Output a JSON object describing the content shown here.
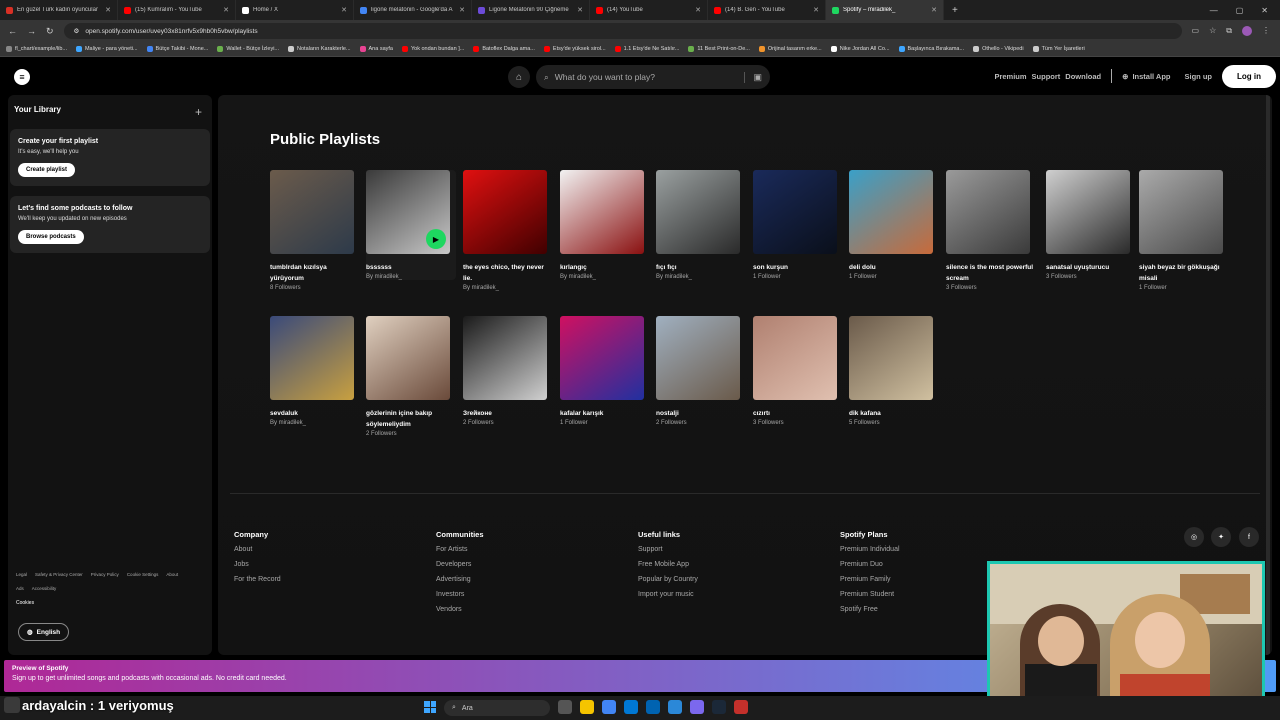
{
  "browser": {
    "tabs": [
      {
        "title": "En güzel Türk kadın oyuncular",
        "color": "#d93025"
      },
      {
        "title": "(15) Kumralım - YouTube",
        "color": "#ff0000"
      },
      {
        "title": "Home / X",
        "color": "#ffffff"
      },
      {
        "title": "ligone melatonin - Google'da A",
        "color": "#4285f4"
      },
      {
        "title": "Ligone Melatonin 90 Çiğneme",
        "color": "#6c4bd8"
      },
      {
        "title": "(14) YouTube",
        "color": "#ff0000"
      },
      {
        "title": "(14) B. Gen - YouTube",
        "color": "#ff0000"
      },
      {
        "title": "Spotify – miradilek_",
        "color": "#1ed760"
      }
    ],
    "url": "open.spotify.com/user/uvey03x81nrfv5x9hb0h5vbw/playlists",
    "bookmarks": [
      {
        "label": "fl_chart/example/lib...",
        "color": "#888888"
      },
      {
        "label": "Maliye - para yöneti...",
        "color": "#3ea6ff"
      },
      {
        "label": "Bütçe Takibi - Mone...",
        "color": "#4285f4"
      },
      {
        "label": "Wallet - Bütçe İzleyi...",
        "color": "#6ab04c"
      },
      {
        "label": "Notaların Karakterle...",
        "color": "#cccccc"
      },
      {
        "label": "Ana sayfa",
        "color": "#e84393"
      },
      {
        "label": "Yok ondan bundan ]...",
        "color": "#ff0000"
      },
      {
        "label": "Batoflex Dalga ama...",
        "color": "#ff0000"
      },
      {
        "label": "Etsy'de yüksek sirol...",
        "color": "#ff0000"
      },
      {
        "label": "1.1 Etsy'de Ne Satılır...",
        "color": "#ff0000"
      },
      {
        "label": "11 Best Print-on-De...",
        "color": "#6ab04c"
      },
      {
        "label": "Orijinal tasarım erke...",
        "color": "#f0932b"
      },
      {
        "label": "Nike Jordan All Co...",
        "color": "#ffffff"
      },
      {
        "label": "Başlayınca Bırakama...",
        "color": "#3ea6ff"
      },
      {
        "label": "Othello - Vikipedi",
        "color": "#cccccc"
      },
      {
        "label": "Tüm Yer İşaretleri",
        "color": "#cccccc"
      }
    ]
  },
  "spotify_header": {
    "search_placeholder": "What do you want to play?",
    "links": [
      "Premium",
      "Support",
      "Download"
    ],
    "install": "Install App",
    "signup": "Sign up",
    "login": "Log in"
  },
  "library": {
    "title": "Your Library",
    "card1": {
      "title": "Create your first playlist",
      "text": "It's easy, we'll help you",
      "button": "Create playlist"
    },
    "card2": {
      "title": "Let's find some podcasts to follow",
      "text": "We'll keep you updated on new episodes",
      "button": "Browse podcasts"
    },
    "legal": [
      "Legal",
      "Safety & Privacy Center",
      "Privacy Policy",
      "Cookie Settings",
      "About Ads",
      "Accessibility"
    ],
    "cookies": "Cookies",
    "language": "English"
  },
  "main": {
    "title": "Public Playlists",
    "playlists": [
      {
        "name": "tumblrdan kızılsya yürüyorum",
        "sub": "8 Followers",
        "art": [
          "#6b5b4b",
          "#2d3a4a"
        ]
      },
      {
        "name": "bssssss",
        "sub": "By miradilek_",
        "art": [
          "#3a3a3a",
          "#c8c8c8"
        ]
      },
      {
        "name": "the eyes chico, they never lie.",
        "sub": "By miradilek_",
        "art": [
          "#e01010",
          "#400000"
        ]
      },
      {
        "name": "kırlangıç",
        "sub": "By miradilek_",
        "art": [
          "#f2f2f2",
          "#8a1010"
        ]
      },
      {
        "name": "fıçı fıçı",
        "sub": "By miradilek_",
        "art": [
          "#9aa0a0",
          "#2a2a2a"
        ]
      },
      {
        "name": "son kurşun",
        "sub": "1 Follower",
        "art": [
          "#1a2a5a",
          "#0a0f1a"
        ]
      },
      {
        "name": "deli dolu",
        "sub": "1 Follower",
        "art": [
          "#3aa0c8",
          "#c86a3a"
        ]
      },
      {
        "name": "silence is the most powerful scream",
        "sub": "3 Followers",
        "art": [
          "#9a9a9a",
          "#3a3a3a"
        ]
      },
      {
        "name": "sanatsal uyuşturucu",
        "sub": "3 Followers",
        "art": [
          "#cfcfcf",
          "#2a2a2a"
        ]
      },
      {
        "name": "siyah beyaz bir gökkuşağı misali",
        "sub": "1 Follower",
        "art": [
          "#aaaaaa",
          "#4a4a4a"
        ]
      },
      {
        "name": "sevdaluk",
        "sub": "By miradilek_",
        "art": [
          "#3a4a7a",
          "#c8a040"
        ]
      },
      {
        "name": "gözlerinin içine bakıp söylemeliydim",
        "sub": "2 Followers",
        "art": [
          "#e0d0c0",
          "#6a4a3a"
        ]
      },
      {
        "name": "Зrейконе",
        "sub": "2 Followers",
        "art": [
          "#1a1a1a",
          "#d0d0d0"
        ]
      },
      {
        "name": "kafalar karışık",
        "sub": "1 Follower",
        "art": [
          "#d01060",
          "#2030a0"
        ]
      },
      {
        "name": "nostalji",
        "sub": "2 Followers",
        "art": [
          "#a0b0c0",
          "#6a5a4a"
        ]
      },
      {
        "name": "cızırtı",
        "sub": "3 Followers",
        "art": [
          "#b08070",
          "#e0c0b0"
        ]
      },
      {
        "name": "dik kafana",
        "sub": "5 Followers",
        "art": [
          "#6a5a4a",
          "#d0c0a0"
        ]
      }
    ]
  },
  "footer": {
    "columns": [
      {
        "title": "Company",
        "items": [
          "About",
          "Jobs",
          "For the Record"
        ]
      },
      {
        "title": "Communities",
        "items": [
          "For Artists",
          "Developers",
          "Advertising",
          "Investors",
          "Vendors"
        ]
      },
      {
        "title": "Useful links",
        "items": [
          "Support",
          "Free Mobile App",
          "Popular by Country",
          "Import your music"
        ]
      },
      {
        "title": "Spotify Plans",
        "items": [
          "Premium Individual",
          "Premium Duo",
          "Premium Family",
          "Premium Student",
          "Spotify Free"
        ]
      }
    ]
  },
  "preview": {
    "title": "Preview of Spotify",
    "text": "Sign up to get unlimited songs and podcasts with occasional ads. No credit card needed."
  },
  "overlay": {
    "text": "ardayalcin : 1 veriyomuş"
  },
  "taskbar": {
    "search": "Ara"
  }
}
